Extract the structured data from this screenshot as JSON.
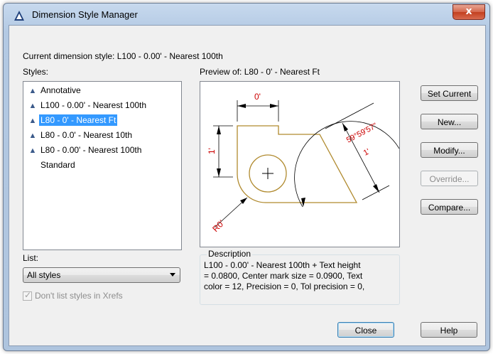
{
  "window": {
    "title": "Dimension Style Manager",
    "close_glyph": "x"
  },
  "current_style_label": "Current dimension style: L100 - 0.00' - Nearest 100th",
  "styles_label": "Styles:",
  "styles": [
    {
      "name": "Annotative",
      "icon": "annotative-triangle-icon",
      "selected": false
    },
    {
      "name": "L100 - 0.00' - Nearest 100th",
      "icon": "annotative-triangle-icon",
      "selected": false
    },
    {
      "name": "L80 - 0' - Nearest Ft",
      "icon": "annotative-triangle-icon",
      "selected": true
    },
    {
      "name": "L80 - 0.0' - Nearest 10th",
      "icon": "annotative-triangle-icon",
      "selected": false
    },
    {
      "name": "L80 - 0.00' - Nearest 100th",
      "icon": "annotative-triangle-icon",
      "selected": false
    },
    {
      "name": "Standard",
      "icon": "",
      "selected": false
    }
  ],
  "preview_label": "Preview of: L80 - 0' - Nearest Ft",
  "preview": {
    "dim_top": "0'",
    "dim_left": "1'",
    "dim_radius": "R0'",
    "dim_angle": "59°59'57\"",
    "dim_angle_small": "1'",
    "colors": {
      "outline": "#b08a2e",
      "dims": "#000000",
      "text": "#cc0000"
    }
  },
  "buttons": {
    "set_current": "Set Current",
    "new": "New...",
    "modify": "Modify...",
    "override": "Override...",
    "compare": "Compare...",
    "close": "Close",
    "help": "Help"
  },
  "list_label": "List:",
  "list_value": "All styles",
  "xrefs_checkbox": {
    "label": "Don't list styles in Xrefs",
    "checked": true,
    "disabled": true
  },
  "description": {
    "legend": "Description",
    "line1": "L100 - 0.00' - Nearest 100th + Text height",
    "line2": "= 0.0800, Center mark size = 0.0900, Text",
    "line3": "color = 12, Precision = 0, Tol precision = 0,"
  },
  "colors": {
    "selection": "#3399ff",
    "dialog_bg": "#f0f0f0",
    "close_button": "#c2401f"
  }
}
